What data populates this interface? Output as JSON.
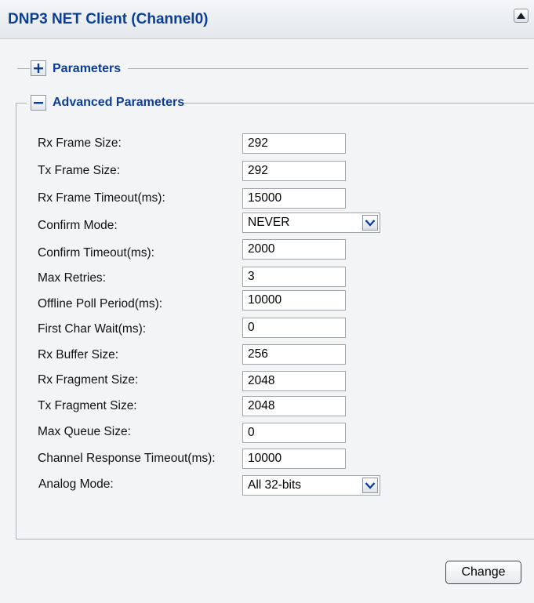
{
  "header": {
    "title": "DNP3 NET Client (Channel0)",
    "collapse_icon": "triangle-up-icon"
  },
  "sections": {
    "parameters": {
      "label": "Parameters",
      "state": "collapsed",
      "icon": "plus-icon"
    },
    "advanced": {
      "label": "Advanced Parameters",
      "state": "expanded",
      "icon": "minus-icon"
    }
  },
  "fields": [
    {
      "label": "Rx Frame Size:",
      "value": "292",
      "type": "text"
    },
    {
      "label": "Tx Frame Size:",
      "value": "292",
      "type": "text"
    },
    {
      "label": "Rx Frame Timeout(ms):",
      "value": "15000",
      "type": "text"
    },
    {
      "label": "Confirm Mode:",
      "value": "NEVER",
      "type": "select"
    },
    {
      "label": "Confirm Timeout(ms):",
      "value": "2000",
      "type": "text"
    },
    {
      "label": "Max Retries:",
      "value": "3",
      "type": "text"
    },
    {
      "label": "Offline Poll Period(ms):",
      "value": "10000",
      "type": "text"
    },
    {
      "label": "First Char Wait(ms):",
      "value": "0",
      "type": "text"
    },
    {
      "label": "Rx Buffer Size:",
      "value": "256",
      "type": "text"
    },
    {
      "label": "Rx Fragment Size:",
      "value": "2048",
      "type": "text"
    },
    {
      "label": "Tx Fragment Size:",
      "value": "2048",
      "type": "text"
    },
    {
      "label": "Max Queue Size:",
      "value": "0",
      "type": "text"
    },
    {
      "label": "Channel Response Timeout(ms):",
      "value": "10000",
      "type": "text"
    },
    {
      "label": "Analog Mode:",
      "value": "All 32-bits",
      "type": "select"
    }
  ],
  "actions": {
    "change_label": "Change"
  },
  "colors": {
    "title": "#0b3f96",
    "background": "#f3f4f6",
    "border": "#aab1b8"
  }
}
